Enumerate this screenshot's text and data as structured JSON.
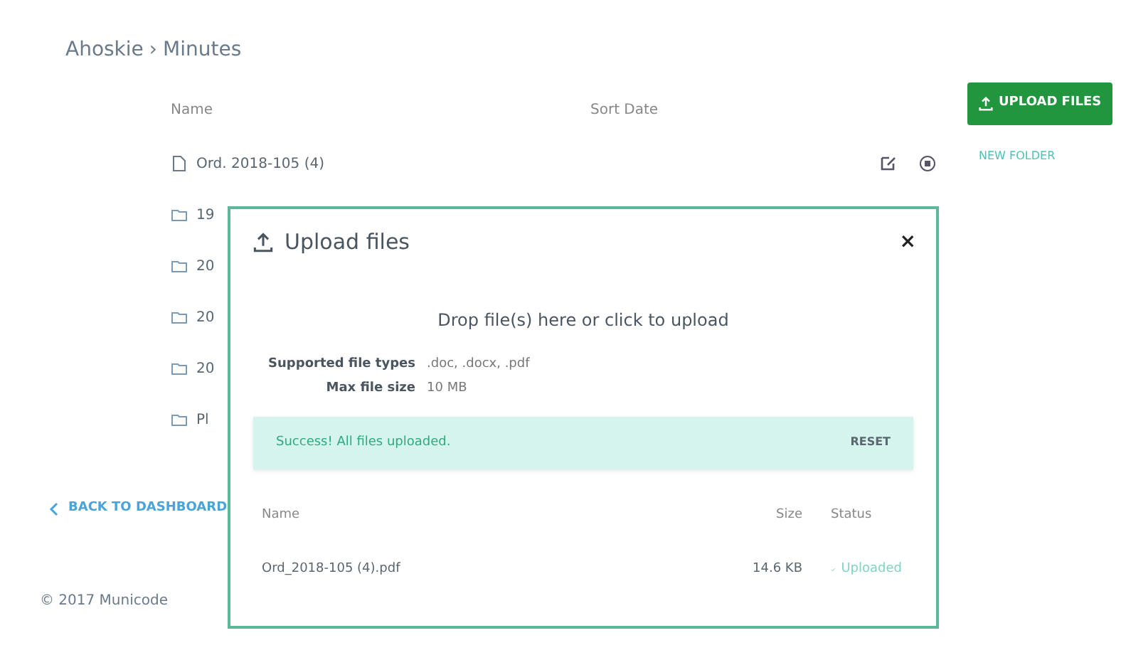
{
  "breadcrumb": {
    "parent": "Ahoskie",
    "separator": "›",
    "current": "Minutes"
  },
  "list": {
    "columns": [
      "Name",
      "Sort Date"
    ],
    "rows": [
      {
        "kind": "file",
        "name": "Ord. 2018-105 (4)"
      },
      {
        "kind": "folder",
        "name": "19"
      },
      {
        "kind": "folder",
        "name": "20"
      },
      {
        "kind": "folder",
        "name": "20"
      },
      {
        "kind": "folder",
        "name": "20"
      },
      {
        "kind": "folder",
        "name": "Pl"
      }
    ]
  },
  "actions": {
    "upload": "UPLOAD FILES",
    "new_folder": "NEW FOLDER"
  },
  "back_link": "BACK TO DASHBOARD",
  "footer": "© 2017 Municode",
  "modal": {
    "title": "Upload files",
    "close": "×",
    "drop_text": "Drop file(s) here or click to upload",
    "info": [
      {
        "label": "Supported file types",
        "value": ".doc, .docx, .pdf"
      },
      {
        "label": "Max file size",
        "value": "10 MB"
      }
    ],
    "alert": {
      "message": "Success! All files uploaded.",
      "action": "RESET"
    },
    "columns": [
      "Name",
      "Size",
      "Status"
    ],
    "files": [
      {
        "name": "Ord_2018-105 (4).pdf",
        "size": "14.6 KB",
        "status": "Uploaded"
      }
    ]
  }
}
